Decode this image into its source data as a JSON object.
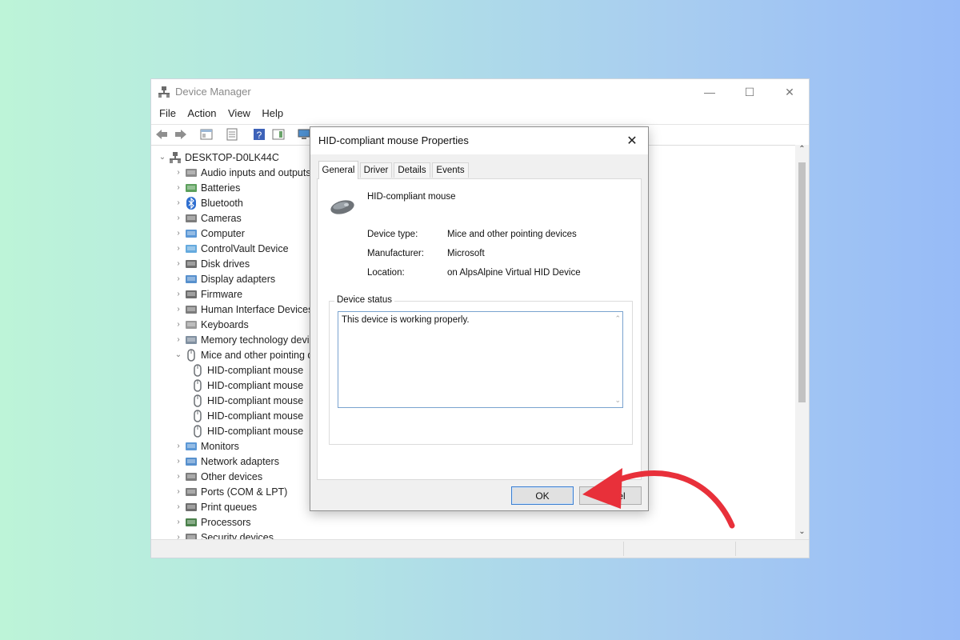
{
  "window": {
    "title": "Device Manager",
    "minimize_icon": "—",
    "maximize_icon": "☐",
    "close_icon": "✕"
  },
  "menu": [
    "File",
    "Action",
    "View",
    "Help"
  ],
  "tree": {
    "root": "DESKTOP-D0LK44C",
    "items": [
      {
        "label": "Audio inputs and outputs",
        "icon": "speaker-icon",
        "expanded": false
      },
      {
        "label": "Batteries",
        "icon": "battery-icon",
        "expanded": false
      },
      {
        "label": "Bluetooth",
        "icon": "bluetooth-icon",
        "expanded": false
      },
      {
        "label": "Cameras",
        "icon": "camera-icon",
        "expanded": false
      },
      {
        "label": "Computer",
        "icon": "computer-icon",
        "expanded": false
      },
      {
        "label": "ControlVault Device",
        "icon": "controlvault-icon",
        "expanded": false
      },
      {
        "label": "Disk drives",
        "icon": "disk-drive-icon",
        "expanded": false
      },
      {
        "label": "Display adapters",
        "icon": "display-adapter-icon",
        "expanded": false
      },
      {
        "label": "Firmware",
        "icon": "firmware-icon",
        "expanded": false
      },
      {
        "label": "Human Interface Devices",
        "icon": "hid-icon",
        "expanded": false
      },
      {
        "label": "Keyboards",
        "icon": "keyboard-icon",
        "expanded": false
      },
      {
        "label": "Memory technology devices",
        "icon": "memory-icon",
        "expanded": false
      },
      {
        "label": "Mice and other pointing devices",
        "icon": "mouse-icon",
        "expanded": true
      },
      {
        "label": "HID-compliant mouse",
        "icon": "mouse-icon",
        "child": true
      },
      {
        "label": "HID-compliant mouse",
        "icon": "mouse-icon",
        "child": true
      },
      {
        "label": "HID-compliant mouse",
        "icon": "mouse-icon",
        "child": true
      },
      {
        "label": "HID-compliant mouse",
        "icon": "mouse-icon",
        "child": true
      },
      {
        "label": "HID-compliant mouse",
        "icon": "mouse-icon",
        "child": true
      },
      {
        "label": "Monitors",
        "icon": "monitor-icon",
        "expanded": false
      },
      {
        "label": "Network adapters",
        "icon": "network-adapter-icon",
        "expanded": false
      },
      {
        "label": "Other devices",
        "icon": "other-devices-icon",
        "expanded": false
      },
      {
        "label": "Ports (COM & LPT)",
        "icon": "port-icon",
        "expanded": false
      },
      {
        "label": "Print queues",
        "icon": "printer-icon",
        "expanded": false
      },
      {
        "label": "Processors",
        "icon": "processor-icon",
        "expanded": false
      },
      {
        "label": "Security devices",
        "icon": "security-icon",
        "expanded": false
      }
    ]
  },
  "dialog": {
    "title": "HID-compliant mouse Properties",
    "close_icon": "✕",
    "tabs": [
      "General",
      "Driver",
      "Details",
      "Events"
    ],
    "active_tab": "General",
    "device_name": "HID-compliant mouse",
    "fields": [
      {
        "label": "Device type:",
        "value": "Mice and other pointing devices"
      },
      {
        "label": "Manufacturer:",
        "value": "Microsoft"
      },
      {
        "label": "Location:",
        "value": "on AlpsAlpine Virtual HID Device"
      }
    ],
    "status_legend": "Device status",
    "status_text": "This device is working properly.",
    "ok_label": "OK",
    "cancel_label": "Cancel"
  },
  "annotation": {
    "color": "#e8303a"
  }
}
